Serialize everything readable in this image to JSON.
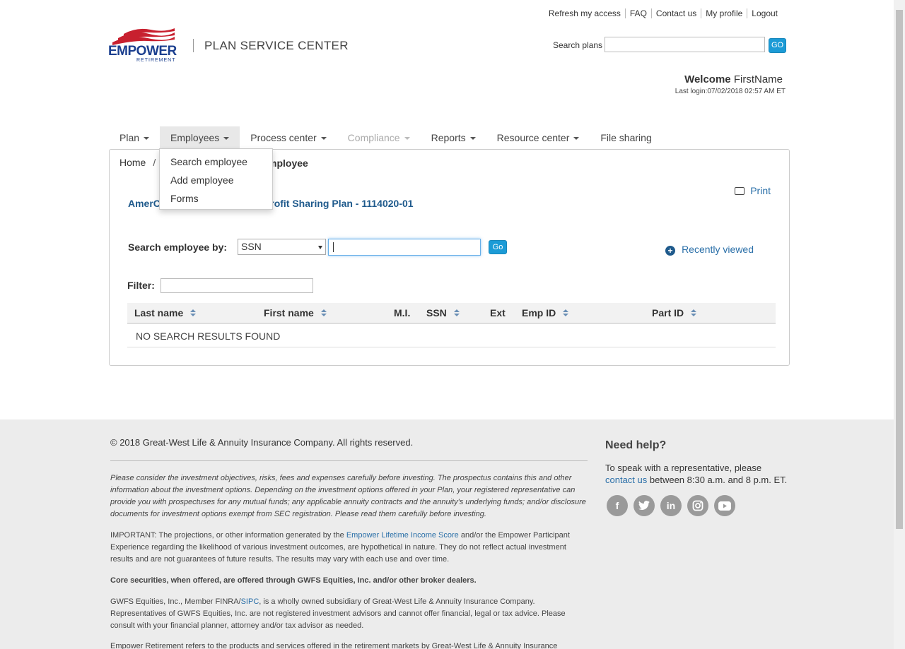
{
  "toplinks": {
    "refresh": "Refresh my access",
    "faq": "FAQ",
    "contact": "Contact us",
    "profile": "My profile",
    "logout": "Logout"
  },
  "header": {
    "logo_text": "EMPOWER",
    "logo_sub": "RETIREMENT",
    "app_title": "PLAN SERVICE CENTER",
    "search_label": "Search plans",
    "search_value": "",
    "search_go": "GO",
    "welcome_label": "Welcome",
    "welcome_name": "FirstName",
    "last_login": "Last login:07/02/2018 02:57 AM ET"
  },
  "nav": {
    "items": [
      "Plan",
      "Employees",
      "Process center",
      "Compliance",
      "Reports",
      "Resource center",
      "File sharing"
    ]
  },
  "employees_menu": {
    "options": [
      "Search employee",
      "Add employee",
      "Forms"
    ]
  },
  "main": {
    "breadcrumb_home": "Home",
    "breadcrumb_sep": "/",
    "breadcrumb_current": "mployee",
    "print": "Print",
    "plan_name_start": "AmerC",
    "plan_name_end": "Profit Sharing Plan - 1114020-01",
    "search_by_label": "Search employee by:",
    "search_by_selected": "SSN",
    "search_value": "",
    "search_go": "Go",
    "recently_viewed": "Recently viewed",
    "filter_label": "Filter:",
    "filter_value": "",
    "columns": [
      "Last name",
      "First name",
      "M.I.",
      "SSN",
      "Ext",
      "Emp ID",
      "Part ID"
    ],
    "no_results": "NO SEARCH RESULTS FOUND"
  },
  "footer": {
    "copyright": "© 2018 Great-West Life & Annuity Insurance Company. All rights reserved.",
    "p1": "Please consider the investment objectives, risks, fees and expenses carefully before investing. The prospectus contains this and other information about the investment options. Depending on the investment options offered in your Plan, your registered representative can provide you with prospectuses for any mutual funds; any applicable annuity contracts and the annuity's underlying funds; and/or disclosure documents for investment options exempt from SEC registration. Please read them carefully before investing.",
    "p2_a": "IMPORTANT: The projections, or other information generated by the ",
    "p2_link": "Empower Lifetime Income Score",
    "p2_b": " and/or the Empower Participant Experience regarding the likelihood of various investment outcomes, are hypothetical in nature. They do not reflect actual investment results and are not guarantees of future results. The results may vary with each use and over time.",
    "p3": "Core securities, when offered, are offered through GWFS Equities, Inc. and/or other broker dealers.",
    "p4_a": "GWFS Equities, Inc., Member FINRA/",
    "p4_link": "SIPC",
    "p4_b": ", is a wholly owned subsidiary of Great-West Life & Annuity Insurance Company. Representatives of GWFS Equities, Inc. are not registered investment advisors and cannot offer financial, legal or tax advice. Please consult with your financial planner, attorney and/or tax advisor as needed.",
    "p5": "Empower Retirement refers to the products and services offered in the retirement markets by Great-West Life & Annuity Insurance",
    "help_title": "Need help?",
    "help_a": "To speak with a representative, please",
    "help_link": "contact us",
    "help_b": " between 8:30 a.m. and 8 p.m. ET.",
    "social_icons": [
      "facebook-icon",
      "twitter-icon",
      "linkedin-icon",
      "instagram-icon",
      "youtube-icon"
    ]
  },
  "colors": {
    "brand_blue": "#1b3f8f",
    "brand_red": "#c8202f",
    "go_button": "#1c9bd6",
    "link": "#2a6fa8"
  }
}
